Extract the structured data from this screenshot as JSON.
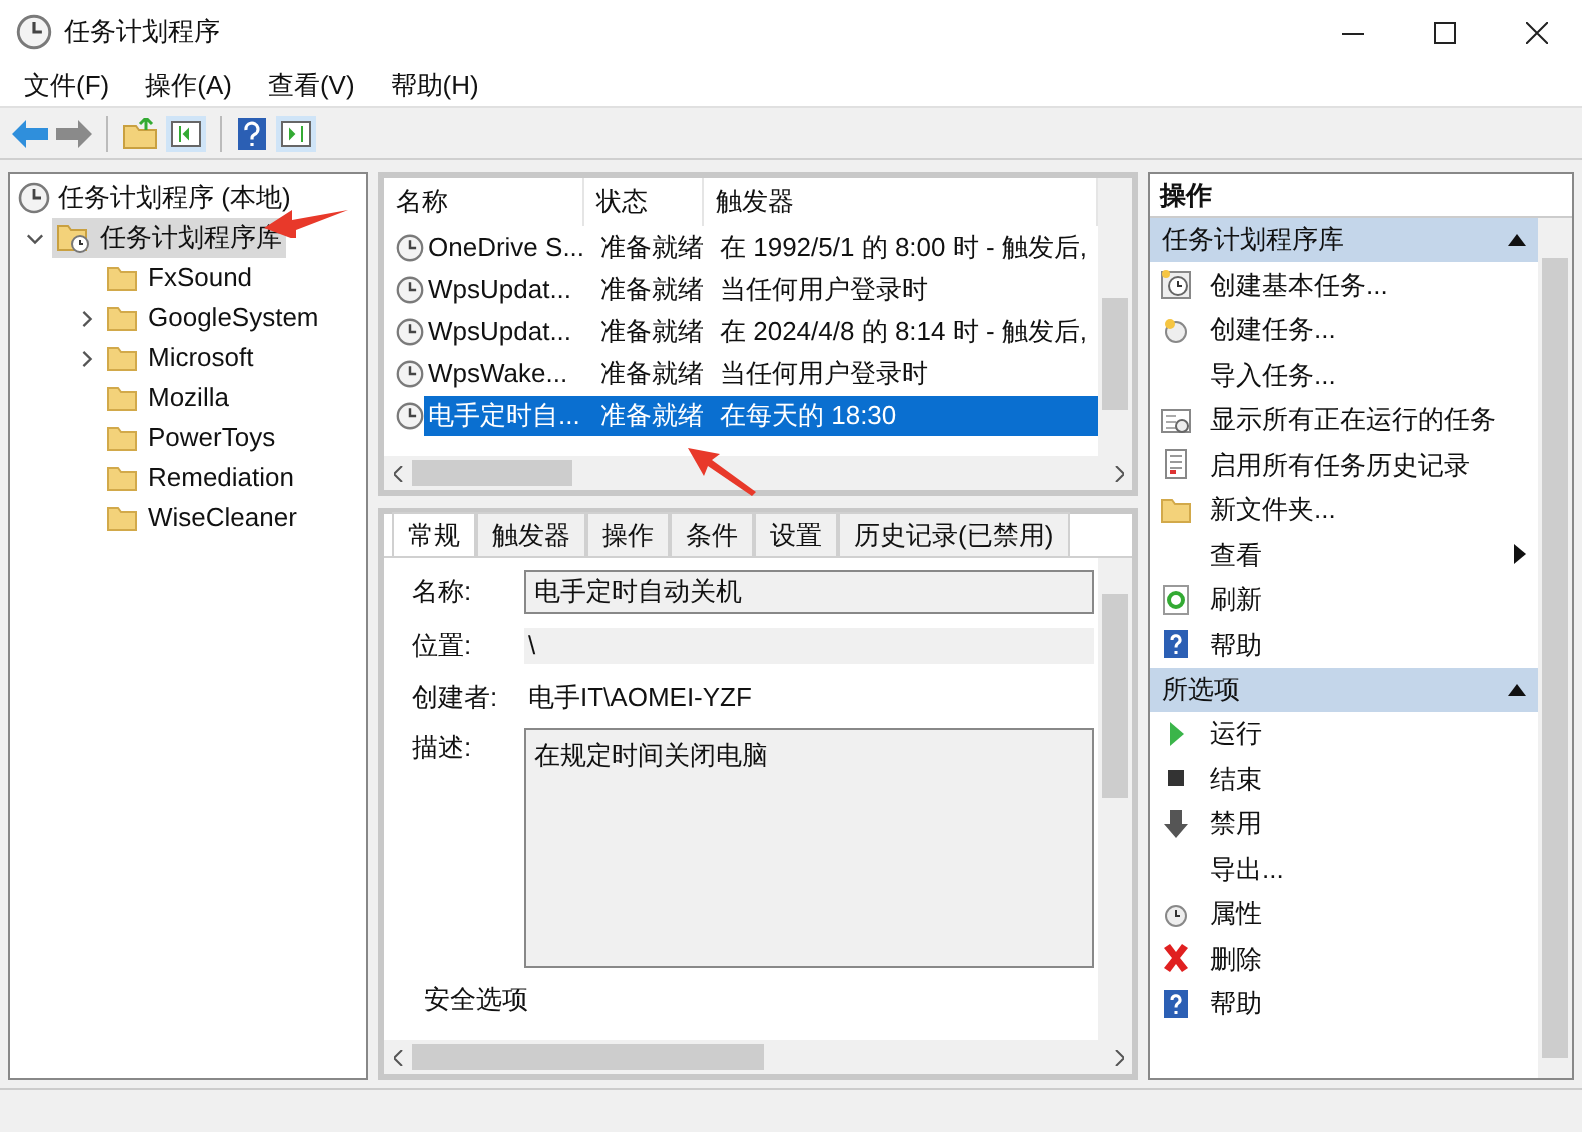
{
  "window": {
    "title": "任务计划程序"
  },
  "menu": [
    "文件(F)",
    "操作(A)",
    "查看(V)",
    "帮助(H)"
  ],
  "tree": {
    "label": "任务计划程序 (本地)",
    "children": [
      {
        "label": "任务计划程序库",
        "selected": true,
        "expanded": true,
        "children": [
          {
            "label": "FxSound",
            "expandable": false
          },
          {
            "label": "GoogleSystem",
            "expandable": true
          },
          {
            "label": "Microsoft",
            "expandable": true
          },
          {
            "label": "Mozilla",
            "expandable": false
          },
          {
            "label": "PowerToys",
            "expandable": false
          },
          {
            "label": "Remediation",
            "expandable": false
          },
          {
            "label": "WiseCleaner",
            "expandable": false
          }
        ]
      }
    ]
  },
  "task_list": {
    "columns": [
      "名称",
      "状态",
      "触发器"
    ],
    "rows": [
      {
        "name": "OneDrive S...",
        "status": "准备就绪",
        "trigger": "在 1992/5/1 的 8:00 时 - 触发后,",
        "selected": false
      },
      {
        "name": "WpsUpdat...",
        "status": "准备就绪",
        "trigger": "当任何用户登录时",
        "selected": false
      },
      {
        "name": "WpsUpdat...",
        "status": "准备就绪",
        "trigger": "在 2024/4/8 的 8:14 时 - 触发后,",
        "selected": false
      },
      {
        "name": "WpsWake...",
        "status": "准备就绪",
        "trigger": "当任何用户登录时",
        "selected": false
      },
      {
        "name": "电手定时自...",
        "status": "准备就绪",
        "trigger": "在每天的 18:30",
        "selected": true
      }
    ]
  },
  "details": {
    "tabs": [
      {
        "label": "常规",
        "selected": true
      },
      {
        "label": "触发器",
        "selected": false
      },
      {
        "label": "操作",
        "selected": false
      },
      {
        "label": "条件",
        "selected": false
      },
      {
        "label": "设置",
        "selected": false
      },
      {
        "label": "历史记录(已禁用)",
        "selected": false
      }
    ],
    "name_label": "名称:",
    "name_value": "电手定时自动关机",
    "location_label": "位置:",
    "location_value": "\\",
    "author_label": "创建者:",
    "author_value": "电手IT\\AOMEI-YZF",
    "description_label": "描述:",
    "description_value": "在规定时间关闭电脑",
    "security_heading": "安全选项"
  },
  "actions": {
    "title": "操作",
    "sections": [
      {
        "title": "任务计划程序库",
        "expanded": true,
        "items": [
          {
            "label": "创建基本任务...",
            "submenu": false
          },
          {
            "label": "创建任务...",
            "submenu": false
          },
          {
            "label": "导入任务...",
            "submenu": false
          },
          {
            "label": "显示所有正在运行的任务",
            "submenu": false
          },
          {
            "label": "启用所有任务历史记录",
            "submenu": false
          },
          {
            "label": "新文件夹...",
            "submenu": false
          },
          {
            "label": "查看",
            "submenu": true
          },
          {
            "label": "刷新",
            "submenu": false
          },
          {
            "label": "帮助",
            "submenu": false
          }
        ]
      },
      {
        "title": "所选项",
        "expanded": true,
        "items": [
          {
            "label": "运行",
            "submenu": false
          },
          {
            "label": "结束",
            "submenu": false
          },
          {
            "label": "禁用",
            "submenu": false
          },
          {
            "label": "导出...",
            "submenu": false
          },
          {
            "label": "属性",
            "submenu": false
          },
          {
            "label": "删除",
            "submenu": false
          },
          {
            "label": "帮助",
            "submenu": false
          }
        ]
      }
    ]
  }
}
